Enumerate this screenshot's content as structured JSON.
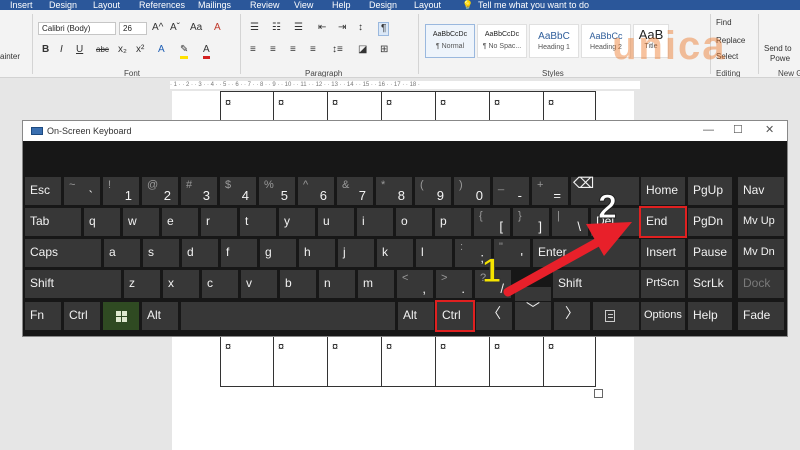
{
  "ribbon_tabs": [
    "Insert",
    "Design",
    "Layout",
    "References",
    "Mailings",
    "Review",
    "View",
    "Help",
    "Design",
    "Layout"
  ],
  "tell_me": "Tell me what you want to do",
  "font": {
    "family": "Calibri (Body)",
    "size": "26",
    "group_label": "Font",
    "buttons": [
      "B",
      "I",
      "U",
      "abc",
      "x₂",
      "x²",
      "A",
      "A"
    ]
  },
  "clipboard_label": "ainter",
  "paragraph": {
    "group_label": "Paragraph",
    "pilcrow": "¶"
  },
  "styles": {
    "group_label": "Styles",
    "items": [
      {
        "sample": "AaBbCcDc",
        "name": "¶ Normal"
      },
      {
        "sample": "AaBbCcDc",
        "name": "¶ No Spac..."
      },
      {
        "sample": "AaBbC",
        "name": "Heading 1"
      },
      {
        "sample": "AaBbCc",
        "name": "Heading 2"
      },
      {
        "sample": "AaB",
        "name": "Title"
      }
    ]
  },
  "editing": {
    "group_label": "Editing",
    "find": "Find",
    "replace": "Replace",
    "select": "Select"
  },
  "new_group": {
    "label_line1": "Send to",
    "label_line2": "Powe",
    "group_label": "New G"
  },
  "watermark": "unica",
  "ruler_text": "· 1 · · 2 · · 3 · · 4 · · 5 · · 6 · · 7 · · 8 · · 9 · · 10 · · 11 · · 12 · · 13 · · 14 · · 15 · · 16 · · 17 · · 18 ·",
  "document": {
    "cell_mark": "¤"
  },
  "osk": {
    "title": "On-Screen Keyboard",
    "minimize": "—",
    "maximize": "☐",
    "close": "✕",
    "row1": [
      {
        "label": "Esc"
      },
      {
        "sub": "~",
        "main": "`"
      },
      {
        "sub": "!",
        "main": "1"
      },
      {
        "sub": "@",
        "main": "2"
      },
      {
        "sub": "#",
        "main": "3"
      },
      {
        "sub": "$",
        "main": "4"
      },
      {
        "sub": "%",
        "main": "5"
      },
      {
        "sub": "^",
        "main": "6"
      },
      {
        "sub": "&",
        "main": "7"
      },
      {
        "sub": "*",
        "main": "8"
      },
      {
        "sub": "(",
        "main": "9"
      },
      {
        "sub": ")",
        "main": "0"
      },
      {
        "sub": "_",
        "main": "-"
      },
      {
        "sub": "+",
        "main": "="
      },
      {
        "label": "⌫"
      }
    ],
    "row2": [
      "Tab",
      "q",
      "w",
      "e",
      "r",
      "t",
      "y",
      "u",
      "i",
      "o",
      "p"
    ],
    "row2_brackets": [
      {
        "sub": "{",
        "main": "["
      },
      {
        "sub": "}",
        "main": "]"
      },
      {
        "sub": "|",
        "main": "\\"
      }
    ],
    "del": "Del",
    "row3": [
      "Caps",
      "a",
      "s",
      "d",
      "f",
      "g",
      "h",
      "j",
      "k",
      "l"
    ],
    "row3_punct": [
      {
        "sub": ":",
        "main": ";"
      },
      {
        "sub": "\"",
        "main": "'"
      }
    ],
    "enter": "Enter",
    "row4": [
      "Shift",
      "z",
      "x",
      "c",
      "v",
      "b",
      "n",
      "m"
    ],
    "row4_punct": [
      {
        "sub": "<",
        "main": ","
      },
      {
        "sub": ">",
        "main": "."
      },
      {
        "sub": "?",
        "main": "/"
      }
    ],
    "shift_right": "Shift",
    "row5": {
      "fn": "Fn",
      "ctrl_left": "Ctrl",
      "alt_left": "Alt",
      "alt_right": "Alt",
      "ctrl_right": "Ctrl",
      "left": "〈",
      "down": "﹀",
      "right": "〉"
    },
    "nav": {
      "home": "Home",
      "pgup": "PgUp",
      "nav": "Nav",
      "end": "End",
      "pgdn": "PgDn",
      "mvup": "Mv Up",
      "insert": "Insert",
      "pause": "Pause",
      "mvdn": "Mv Dn",
      "prtscn": "PrtScn",
      "scrlk": "ScrLk",
      "dock": "Dock",
      "options": "Options",
      "help": "Help",
      "fade": "Fade"
    }
  },
  "annotations": {
    "step1": "1",
    "step2": "2",
    "step1_color": "#f5e400",
    "step2_color": "#ffffff",
    "arrow_color": "#e8202a"
  }
}
